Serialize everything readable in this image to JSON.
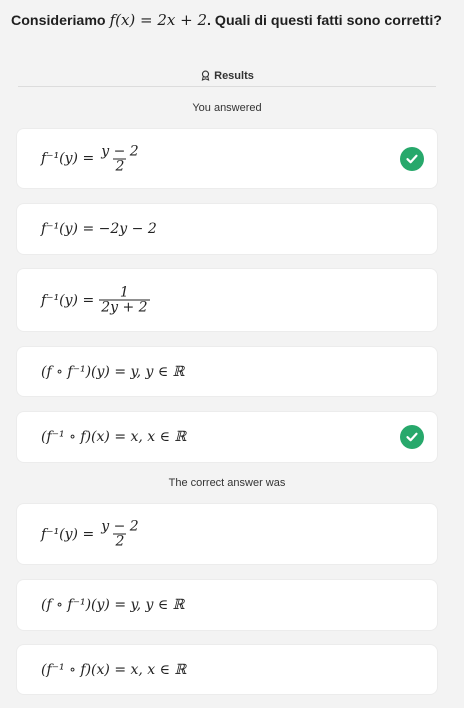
{
  "question": {
    "prefix": "Consideriamo",
    "function": "f(x) = 2x + 2",
    "suffix": ". Quali di questi fatti sono corretti?"
  },
  "results": {
    "heading": "Results",
    "icon": "results-icon"
  },
  "you_answered": {
    "label": "You answered",
    "items": [
      {
        "lhs": "f⁻¹(y) =",
        "num": "y − 2",
        "den": "2",
        "correct": true
      },
      {
        "formula": "f⁻¹(y) = −2y − 2",
        "correct": false
      },
      {
        "lhs": "f⁻¹(y) =",
        "num": "1",
        "den": "2y + 2",
        "correct": false
      },
      {
        "formula": "(f ∘ f⁻¹)(y) = y, y ∈ ℝ",
        "correct": false
      },
      {
        "formula": "(f⁻¹ ∘ f)(x) = x, x ∈ ℝ",
        "correct": true
      }
    ]
  },
  "correct_answer": {
    "label": "The correct answer was",
    "items": [
      {
        "lhs": "f⁻¹(y) =",
        "num": "y − 2",
        "den": "2"
      },
      {
        "formula": "(f ∘ f⁻¹)(y) = y, y ∈ ℝ"
      },
      {
        "formula": "(f⁻¹ ∘ f)(x) = x, x ∈ ℝ"
      }
    ]
  },
  "colors": {
    "check_green": "#27a86b",
    "background": "#f3f3f3"
  }
}
